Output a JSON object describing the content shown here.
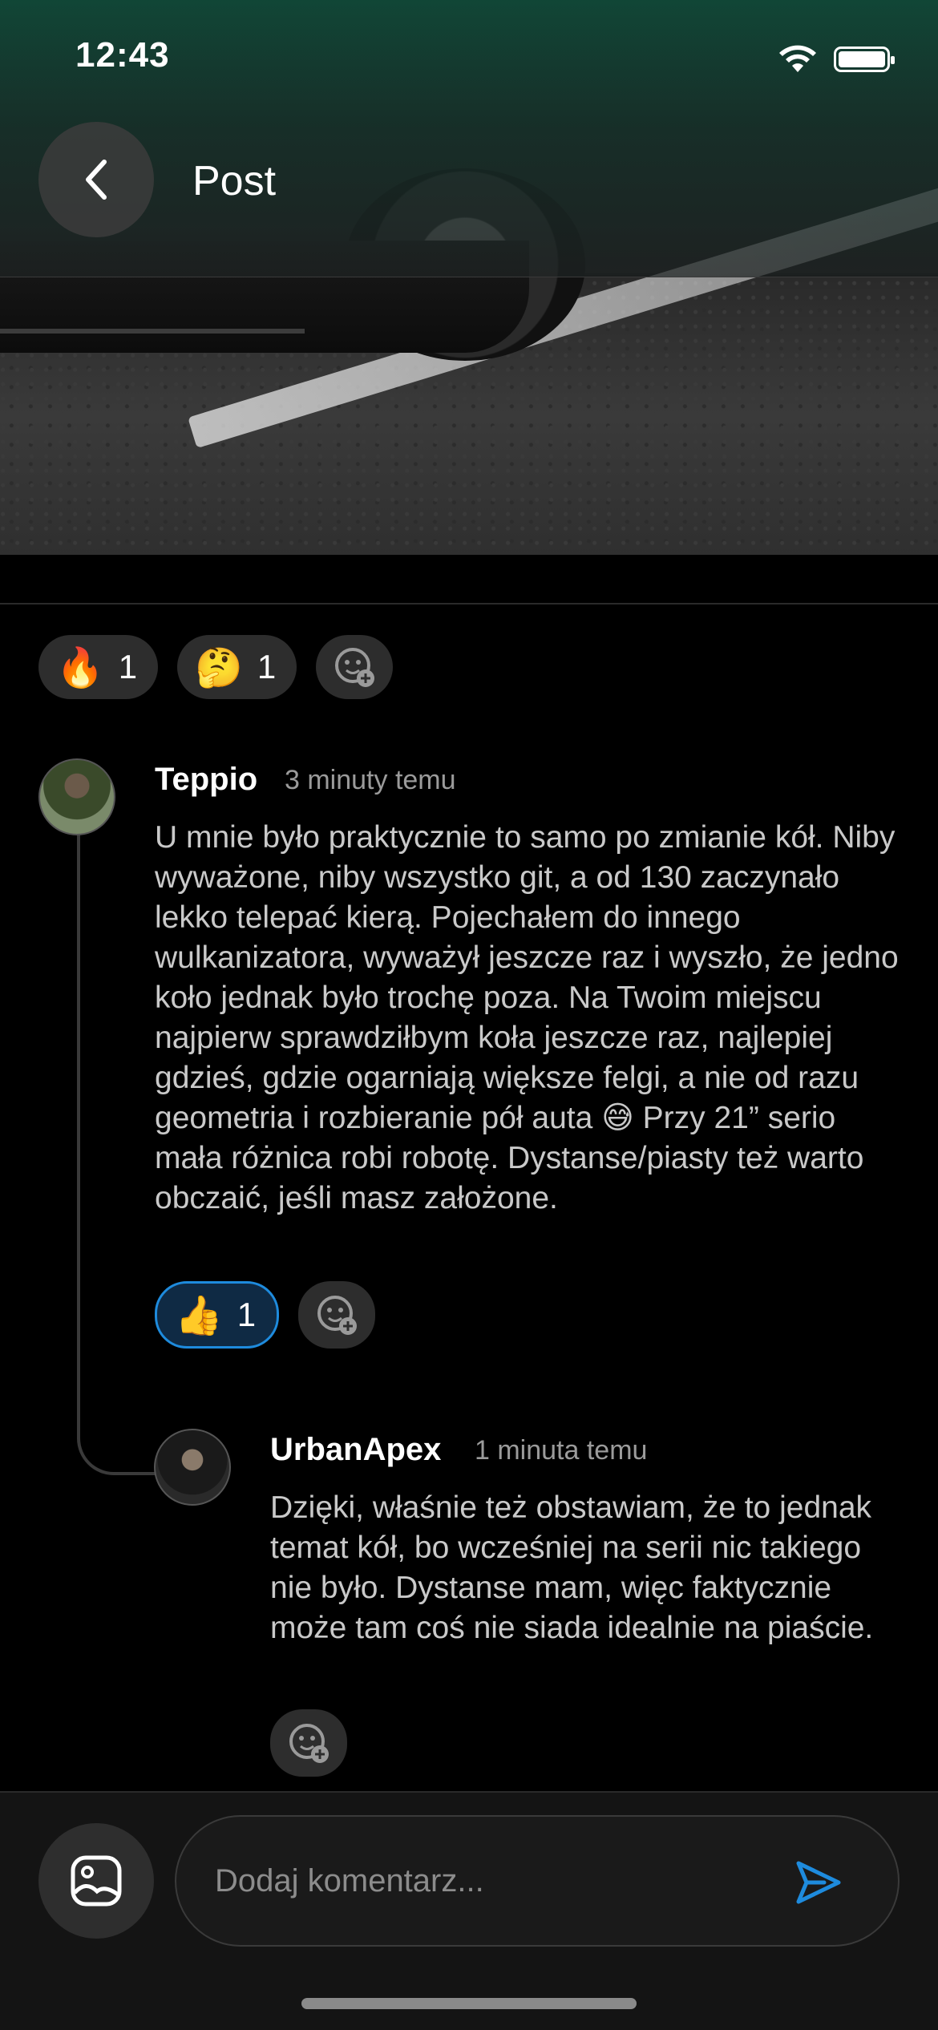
{
  "status_bar": {
    "time": "12:43"
  },
  "header": {
    "title": "Post"
  },
  "post_reactions": [
    {
      "emoji": "🔥",
      "count": "1"
    },
    {
      "emoji": "🤔",
      "count": "1"
    }
  ],
  "comments": [
    {
      "author": "Teppio",
      "time": "3 minuty temu",
      "text": "U mnie było praktycznie to samo po zmianie kół. Niby wyważone, niby wszystko git, a od 130 zaczynało lekko telepać kierą. Pojechałem do innego wulkanizatora, wyważył jeszcze raz i wyszło, że jedno koło jednak było trochę poza. Na Twoim miejscu najpierw sprawdziłbym koła jeszcze raz, najlepiej gdzieś, gdzie ogarniają większe felgi, a nie od razu geometria i rozbieranie pół auta 😅 Przy 21” serio mała różnica robi robotę. Dystanse/piasty też warto obczaić, jeśli masz założone.",
      "reaction": {
        "emoji": "👍",
        "count": "1"
      }
    },
    {
      "author": "UrbanApex",
      "time": "1 minuta temu",
      "text": "Dzięki, właśnie też obstawiam, że to jednak temat kół, bo wcześniej na serii nic takiego nie było. Dystanse mam, więc faktycznie może tam coś nie siada idealnie na piaście."
    }
  ],
  "composer": {
    "placeholder": "Dodaj komentarz..."
  },
  "colors": {
    "accent": "#1e8bdd",
    "background": "#000000"
  }
}
